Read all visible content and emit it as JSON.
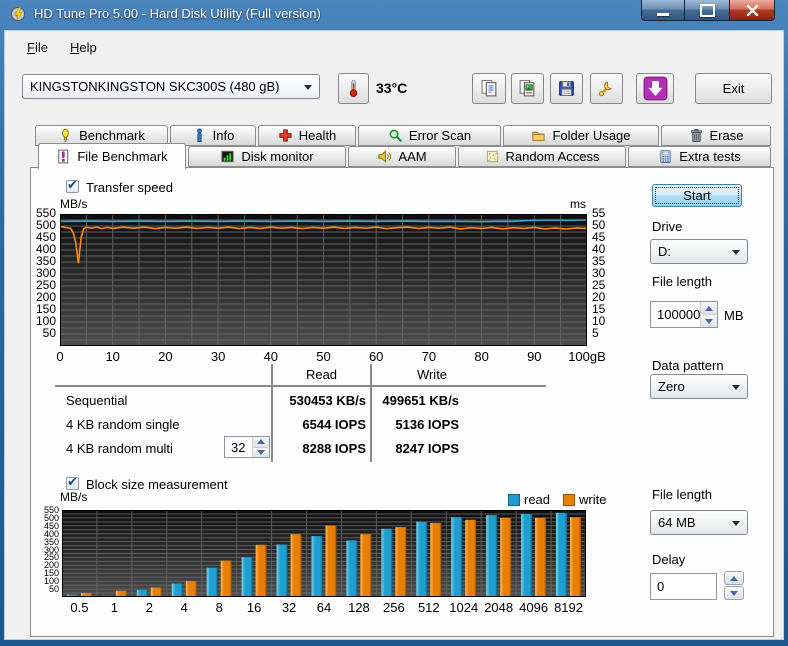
{
  "window": {
    "title": "HD Tune Pro 5.00 - Hard Disk Utility (Full version)"
  },
  "menu": {
    "items": [
      {
        "label": "File"
      },
      {
        "label": "Help"
      }
    ]
  },
  "toolbar": {
    "drive_selector": "KINGSTONKINGSTON SKC300S (480 gB)",
    "temperature": "33°C",
    "buttons": [
      {
        "id": "copy-text"
      },
      {
        "id": "copy-image"
      },
      {
        "id": "save"
      },
      {
        "id": "options"
      },
      {
        "id": "download"
      }
    ],
    "exit_label": "Exit"
  },
  "tabs": {
    "row1": [
      {
        "id": "benchmark",
        "label": "Benchmark"
      },
      {
        "id": "info",
        "label": "Info"
      },
      {
        "id": "health",
        "label": "Health"
      },
      {
        "id": "error-scan",
        "label": "Error Scan"
      },
      {
        "id": "folder-usage",
        "label": "Folder Usage"
      },
      {
        "id": "erase",
        "label": "Erase"
      }
    ],
    "row2": [
      {
        "id": "file-benchmark",
        "label": "File Benchmark",
        "active": true
      },
      {
        "id": "disk-monitor",
        "label": "Disk monitor"
      },
      {
        "id": "aam",
        "label": "AAM"
      },
      {
        "id": "random-access",
        "label": "Random Access"
      },
      {
        "id": "extra-tests",
        "label": "Extra tests"
      }
    ]
  },
  "panel": {
    "transfer_speed_label": "Transfer speed",
    "block_size_label": "Block size measurement",
    "results": {
      "col_read": "Read",
      "col_write": "Write",
      "queue_depth": "32",
      "rows": [
        {
          "label": "Sequential",
          "read": "530453 KB/s",
          "write": "499651 KB/s"
        },
        {
          "label": "4 KB random single",
          "read": "6544 IOPS",
          "write": "5136 IOPS"
        },
        {
          "label": "4 KB random multi",
          "read": "8288 IOPS",
          "write": "8247 IOPS"
        }
      ]
    },
    "controls": {
      "start_label": "Start",
      "drive_label": "Drive",
      "drive_value": "D:",
      "file_length_label": "File length",
      "file_length_value": "100000",
      "file_length_unit": "MB",
      "data_pattern_label": "Data pattern",
      "data_pattern_value": "Zero",
      "block_file_length_label": "File length",
      "block_file_length_value": "64 MB",
      "delay_label": "Delay",
      "delay_value": "0"
    }
  },
  "colors": {
    "read": "#2BA7D8",
    "write": "#FF8C00",
    "bar_read": "#1F9FD0",
    "bar_write": "#E87E04",
    "chart_bg_top": "#0E0E0E",
    "chart_bg_bottom": "#4D4D4D",
    "grid": "#6B6B6B",
    "titlebar_accent": "#2F6AA6"
  },
  "chart_data": [
    {
      "type": "line",
      "title": "Transfer speed",
      "ylabel_left": "MB/s",
      "ylabel_right": "ms",
      "ylim": [
        0,
        550
      ],
      "ylim_right": [
        0,
        55
      ],
      "y_ticks": [
        550,
        500,
        450,
        400,
        350,
        300,
        250,
        200,
        150,
        100,
        50
      ],
      "y_ticks_right": [
        55,
        50,
        45,
        40,
        35,
        30,
        25,
        20,
        15,
        10,
        5
      ],
      "xlim": [
        0,
        100
      ],
      "x_tick_labels": [
        "0",
        "10",
        "20",
        "30",
        "40",
        "50",
        "60",
        "70",
        "80",
        "90",
        "100gB"
      ],
      "grid": {
        "x_step": 5,
        "y_step": 25,
        "grid_on": true
      },
      "series": [
        {
          "name": "read",
          "color": "#2BA7D8",
          "points": [
            [
              0,
              519
            ],
            [
              5,
              520
            ],
            [
              10,
              519
            ],
            [
              15,
              520
            ],
            [
              20,
              519
            ],
            [
              25,
              520
            ],
            [
              30,
              519
            ],
            [
              35,
              520
            ],
            [
              40,
              519
            ],
            [
              45,
              520
            ],
            [
              50,
              519
            ],
            [
              55,
              520
            ],
            [
              60,
              519
            ],
            [
              65,
              520
            ],
            [
              70,
              519
            ],
            [
              75,
              519
            ],
            [
              80,
              518
            ],
            [
              83,
              519
            ],
            [
              86,
              519
            ],
            [
              88,
              522
            ],
            [
              90,
              524
            ],
            [
              93,
              525
            ],
            [
              96,
              524
            ],
            [
              100,
              525
            ]
          ]
        },
        {
          "name": "write",
          "color": "#FF8C00",
          "points": [
            [
              0,
              498
            ],
            [
              1,
              494
            ],
            [
              2,
              490
            ],
            [
              2.5,
              473
            ],
            [
              3,
              430
            ],
            [
              3.5,
              345
            ],
            [
              4,
              452
            ],
            [
              4.5,
              488
            ],
            [
              5,
              495
            ],
            [
              6,
              491
            ],
            [
              7,
              495
            ],
            [
              8,
              489
            ],
            [
              9,
              494
            ],
            [
              10,
              490
            ],
            [
              12,
              495
            ],
            [
              14,
              491
            ],
            [
              16,
              495
            ],
            [
              18,
              489
            ],
            [
              20,
              494
            ],
            [
              22,
              491
            ],
            [
              24,
              495
            ],
            [
              26,
              490
            ],
            [
              28,
              494
            ],
            [
              30,
              491
            ],
            [
              32,
              495
            ],
            [
              34,
              489
            ],
            [
              36,
              494
            ],
            [
              38,
              490
            ],
            [
              40,
              495
            ],
            [
              42,
              491
            ],
            [
              44,
              494
            ],
            [
              46,
              489
            ],
            [
              48,
              494
            ],
            [
              50,
              491
            ],
            [
              52,
              495
            ],
            [
              54,
              490
            ],
            [
              56,
              494
            ],
            [
              58,
              491
            ],
            [
              60,
              495
            ],
            [
              62,
              489
            ],
            [
              64,
              493
            ],
            [
              66,
              495
            ],
            [
              68,
              490
            ],
            [
              70,
              494
            ],
            [
              72,
              491
            ],
            [
              74,
              495
            ],
            [
              76,
              488
            ],
            [
              78,
              493
            ],
            [
              80,
              490
            ],
            [
              82,
              494
            ],
            [
              84,
              488
            ],
            [
              86,
              493
            ],
            [
              88,
              490
            ],
            [
              90,
              494
            ],
            [
              92,
              488
            ],
            [
              94,
              492
            ],
            [
              96,
              487
            ],
            [
              98,
              492
            ],
            [
              100,
              490
            ]
          ]
        }
      ]
    },
    {
      "type": "bar",
      "title": "Block size measurement",
      "ylabel": "MB/s",
      "ylim": [
        0,
        550
      ],
      "y_ticks": [
        550,
        500,
        450,
        400,
        350,
        300,
        250,
        200,
        150,
        100,
        50
      ],
      "categories": [
        "0.5",
        "1",
        "2",
        "4",
        "8",
        "16",
        "32",
        "64",
        "128",
        "256",
        "512",
        "1024",
        "2048",
        "4096",
        "8192"
      ],
      "legend_position": "top-right",
      "series": [
        {
          "name": "read",
          "color": "#1F9FD0",
          "values": [
            15,
            8,
            45,
            85,
            185,
            252,
            332,
            385,
            358,
            432,
            476,
            505,
            518,
            525,
            532
          ]
        },
        {
          "name": "write",
          "color": "#E87E04",
          "values": [
            25,
            40,
            60,
            100,
            230,
            330,
            397,
            452,
            397,
            442,
            468,
            488,
            500,
            501,
            505
          ]
        }
      ]
    }
  ]
}
